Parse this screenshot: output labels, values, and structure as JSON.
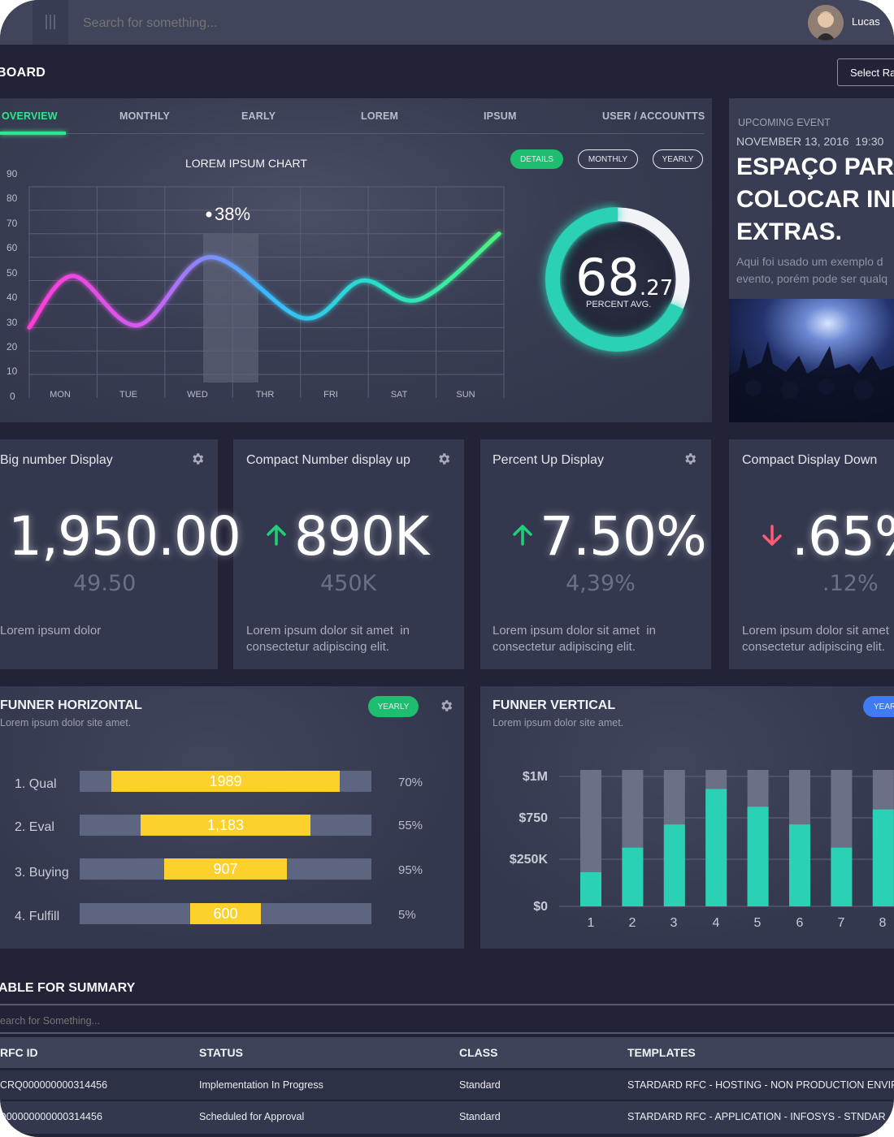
{
  "topbar": {
    "search_placeholder": "Search for something...",
    "user_name": "Lucas"
  },
  "header": {
    "title": "BOARD",
    "select_label": "Select Ra"
  },
  "tabs": [
    "OVERVIEW",
    "MONTHLY",
    "EARLY",
    "LOREM",
    "IPSUM",
    "USER / ACCOUNTTS"
  ],
  "chart_card": {
    "title": "LOREM IPSUM CHART",
    "pills": {
      "details": "DETAILS",
      "monthly": "MONTHLY",
      "yearly": "YEARLY"
    },
    "highlight_label": "38%",
    "gauge": {
      "value_int": "68",
      "value_dec": ".27",
      "label": "PERCENT AVG.",
      "fraction": 0.6827
    }
  },
  "chart_data": {
    "type": "line",
    "title": "LOREM IPSUM CHART",
    "x": [
      "MON",
      "TUE",
      "WED",
      "THR",
      "FRI",
      "SAT",
      "SUN"
    ],
    "yticks": [
      0,
      10,
      20,
      30,
      40,
      50,
      60,
      70,
      80,
      90
    ],
    "ylim": [
      0,
      90
    ],
    "points": [
      {
        "x": 0.0,
        "y": 30
      },
      {
        "x": 0.6,
        "y": 52
      },
      {
        "x": 1.5,
        "y": 31
      },
      {
        "x": 2.5,
        "y": 60
      },
      {
        "x": 3.8,
        "y": 34
      },
      {
        "x": 4.6,
        "y": 50
      },
      {
        "x": 5.4,
        "y": 42
      },
      {
        "x": 6.5,
        "y": 70
      }
    ],
    "highlight": {
      "category": "WED",
      "value": 38
    },
    "grid": true
  },
  "event": {
    "kicker": "UPCOMING EVENT",
    "date": "NOVEMBER 13, 2016  19:30",
    "title_lines": [
      "ESPAÇO PARA",
      "COLOCAR INF",
      "EXTRAS."
    ],
    "desc_lines": [
      "Aqui foi usado um exemplo d",
      "evento, porém pode ser qualq"
    ]
  },
  "kpis": [
    {
      "title": "Big number Display",
      "value": "1,950.00",
      "sub": "49.50",
      "desc_lines": [
        "Lorem ipsum dolor",
        ""
      ],
      "trend": "none"
    },
    {
      "title": "Compact Number display up",
      "value": "890K",
      "sub": "450K",
      "desc_lines": [
        "Lorem ipsum dolor sit amet  in",
        "consectetur adipiscing elit."
      ],
      "trend": "up"
    },
    {
      "title": "Percent Up Display",
      "value": "7.50%",
      "sub": "4,39%",
      "desc_lines": [
        "Lorem ipsum dolor sit amet  in",
        "consectetur adipiscing elit."
      ],
      "trend": "up"
    },
    {
      "title": "Compact Display Down",
      "value": ".65%",
      "sub": ".12%",
      "desc_lines": [
        "Lorem ipsum dolor sit amet",
        "consectetur adipiscing elit."
      ],
      "trend": "down"
    }
  ],
  "funnel_h": {
    "title": "FUNNER HORIZONTAL",
    "subtitle": "Lorem ipsum dolor site amet.",
    "pill": "YEARLY",
    "rows": [
      {
        "label": "1. Qual",
        "value": "1989",
        "pct": "70%",
        "fraction": 0.78
      },
      {
        "label": "2. Eval",
        "value": "1,183",
        "pct": "55%",
        "fraction": 0.58
      },
      {
        "label": "3. Buying",
        "value": "907",
        "pct": "95%",
        "fraction": 0.42
      },
      {
        "label": "4. Fulfill",
        "value": "600",
        "pct": "5%",
        "fraction": 0.24
      }
    ]
  },
  "funnel_v": {
    "title": "FUNNER VERTICAL",
    "subtitle": "Lorem ipsum dolor site amet.",
    "pill": "YEAR",
    "yticks": [
      "$1M",
      "$750",
      "$250K",
      "$0"
    ],
    "categories": [
      "1",
      "2",
      "3",
      "4",
      "5",
      "6",
      "7",
      "8"
    ],
    "values": [
      0.25,
      0.43,
      0.6,
      0.86,
      0.73,
      0.6,
      0.43,
      0.71
    ]
  },
  "summary": {
    "title": "ABLE FOR SUMMARY",
    "search_placeholder": "earch for Something...",
    "columns": [
      "RFC ID",
      "STATUS",
      "CLASS",
      "TEMPLATES"
    ],
    "rows": [
      [
        "CRQ000000000314456",
        "Implementation In Progress",
        "Standard",
        "STARDARD RFC - HOSTING - NON PRODUCTION ENVIR"
      ],
      [
        "Q00000000000314456",
        "Scheduled for Approval",
        "Standard",
        "STARDARD RFC - APPLICATION - INFOSYS - STNDAR"
      ]
    ]
  },
  "colors": {
    "accent_green": "#1fcf7a",
    "teal": "#2ad1b5",
    "yellow": "#fdd12b",
    "down_red": "#ff5c73",
    "blue_pill": "#3f7cf4"
  }
}
